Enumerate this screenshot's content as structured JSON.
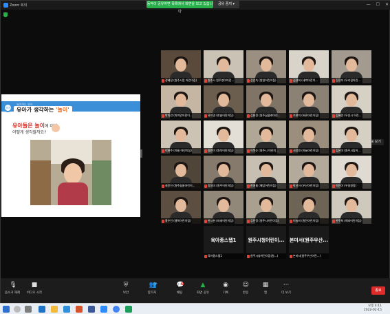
{
  "window": {
    "title": "Zoom 회의",
    "share_banner": "동작이 공유하면 목록에서 화면을 보고 있습니다",
    "stop_share": "공유 중지 ▾",
    "view_label": "⊞ 보기"
  },
  "shared_slide": {
    "tag": "놀이하는 유아",
    "circle_label": "유아",
    "title_prefix": "유아가 생각하는 ",
    "title_highlight": "'놀이'",
    "question_line1_red": "유아들은 놀이",
    "question_line1_rest": "에 대해",
    "question_line2": "어떻게 생각할까요?"
  },
  "gallery": {
    "tiles": [
      {
        "name": "정혜정 (원주시립 어린이집)",
        "bg": "#5a4a3c",
        "muted": true,
        "active": false
      },
      {
        "name": "원주시 원주영아어린...",
        "bg": "#c9c2b5",
        "muted": true,
        "active": false
      },
      {
        "name": "김인숙 (원일어린이집)",
        "bg": "#9a8f80",
        "muted": true,
        "active": false
      },
      {
        "name": "김경희 (새싹어린이...",
        "bg": "#d9d4ca",
        "muted": true,
        "active": false
      },
      {
        "name": "김정숙 (우리집어린...",
        "bg": "#a39b8f",
        "muted": true,
        "active": false
      },
      {
        "name": "박미란 (마미안어린이...",
        "bg": "#c4b6a3",
        "muted": true,
        "active": false
      },
      {
        "name": "유지영 (한솔어린이집)",
        "bg": "#6b5e4f",
        "muted": true,
        "active": true
      },
      {
        "name": "김현정 (원주꿈블래어린...",
        "bg": "#7f7465",
        "muted": true,
        "active": false
      },
      {
        "name": "조현미 (바른어린이집)",
        "bg": "#8b8175",
        "muted": true,
        "active": false
      },
      {
        "name": "김혜련 (우성시 어린...",
        "bg": "#d6d0c5",
        "muted": true,
        "active": false
      },
      {
        "name": "이현주 (아름 어린이집)",
        "bg": "#ccc3b4",
        "muted": true,
        "active": false
      },
      {
        "name": "정란이 (원석어린이집)",
        "bg": "#e3dfd7",
        "muted": true,
        "active": false
      },
      {
        "name": "이복순 (원주시 어린이...",
        "bg": "#b0a797",
        "muted": true,
        "active": false
      },
      {
        "name": "서정원 (하늘어린이집)",
        "bg": "#9c8e7c",
        "muted": true,
        "active": false
      },
      {
        "name": "김유미 (원주시립어...",
        "bg": "#d5cfc4",
        "muted": true,
        "active": false
      },
      {
        "name": "최윤진 (원주꿈들어린이...",
        "bg": "#4f4538",
        "muted": true,
        "active": false
      },
      {
        "name": "정영미 (원주어린이집)",
        "bg": "#857a6b",
        "muted": true,
        "active": false
      },
      {
        "name": "한여름 (해담어린이집)",
        "bg": "#c7bfb1",
        "muted": true,
        "active": false
      },
      {
        "name": "박선아 (우산어린이집)",
        "bg": "#b3aa9b",
        "muted": true,
        "active": false
      },
      {
        "name": "이진아 (우일원정)",
        "bg": "#e0dbd2",
        "muted": true,
        "active": false
      },
      {
        "name": "홍수진 (행복어린이집)",
        "bg": "#5c4f41",
        "muted": true,
        "active": false
      },
      {
        "name": "한시현 (미래어린이집)",
        "bg": "#92887a",
        "muted": true,
        "active": false
      },
      {
        "name": "김민정 (원주시어린이집)",
        "bg": "#a9a090",
        "muted": true,
        "active": false
      },
      {
        "name": "이슬비 (원진어린이집)",
        "bg": "#6e6456",
        "muted": true,
        "active": false
      },
      {
        "name": "한주희 (해피어린이집)",
        "bg": "#cfc8bd",
        "muted": true,
        "active": false
      }
    ],
    "text_tiles": [
      {
        "big": "육아종스텝1",
        "name": "육아종스텝1"
      },
      {
        "big": "원주시청어린이...",
        "name": "원주시청어린이집(원...)"
      },
      {
        "big": "본미서(원주우산...",
        "name": "본미서(원주우산어린...)"
      }
    ]
  },
  "toolbar": {
    "mute": "음소거 해제",
    "video": "비디오 시작",
    "security": "보안",
    "participants": "참가자",
    "participants_count": "29",
    "chat": "채팅",
    "chat_badge": "6",
    "share": "화면 공유",
    "record": "기록",
    "reactions": "반응",
    "apps": "앱",
    "more": "더 보기",
    "end": "종료"
  },
  "taskbar": {
    "time": "오후 4:11",
    "date": "2022-02-15"
  }
}
